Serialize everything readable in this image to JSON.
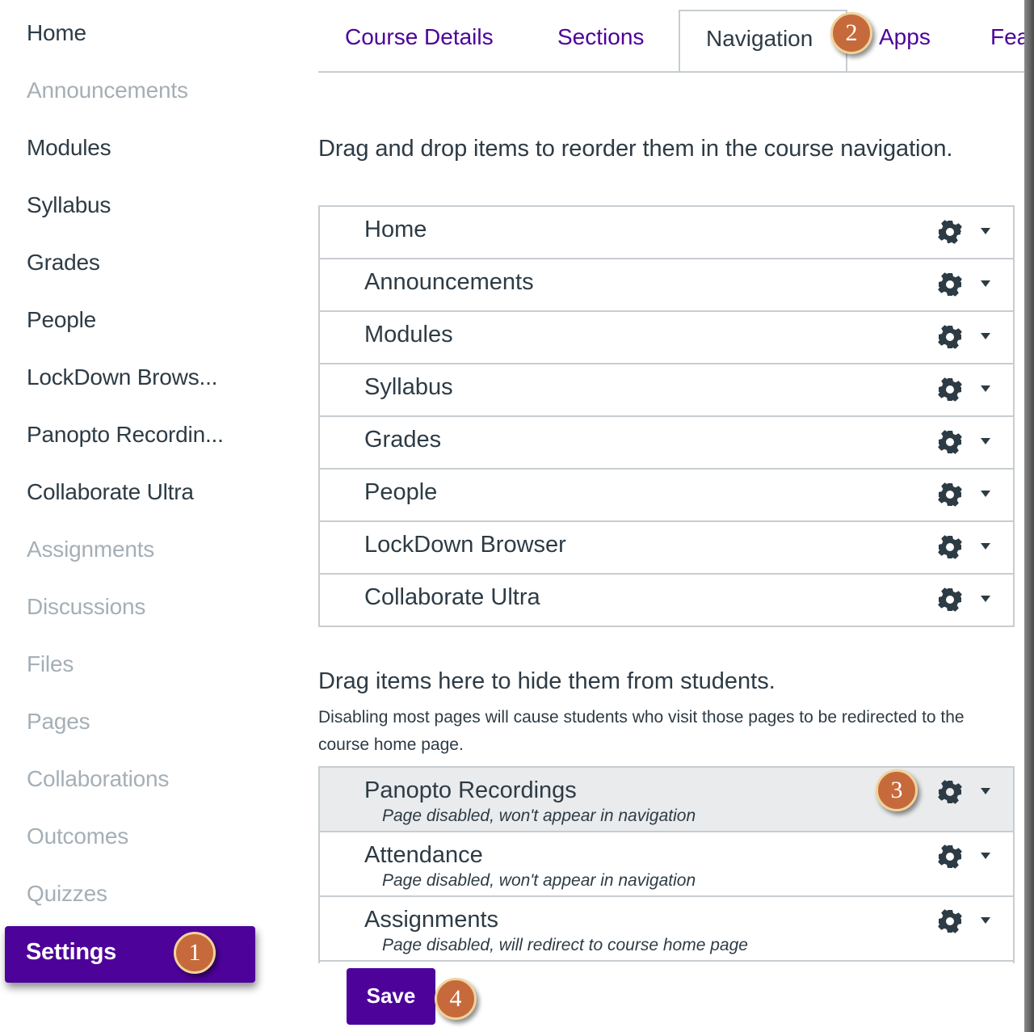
{
  "sidebar": {
    "items": [
      {
        "label": "Home",
        "state": "enabled"
      },
      {
        "label": "Announcements",
        "state": "disabled"
      },
      {
        "label": "Modules",
        "state": "enabled"
      },
      {
        "label": "Syllabus",
        "state": "enabled"
      },
      {
        "label": "Grades",
        "state": "enabled"
      },
      {
        "label": "People",
        "state": "enabled"
      },
      {
        "label": "LockDown Brows...",
        "state": "enabled"
      },
      {
        "label": "Panopto Recordin...",
        "state": "enabled"
      },
      {
        "label": "Collaborate Ultra",
        "state": "enabled"
      },
      {
        "label": "Assignments",
        "state": "disabled"
      },
      {
        "label": "Discussions",
        "state": "disabled"
      },
      {
        "label": "Files",
        "state": "disabled"
      },
      {
        "label": "Pages",
        "state": "disabled"
      },
      {
        "label": "Collaborations",
        "state": "disabled"
      },
      {
        "label": "Outcomes",
        "state": "disabled"
      },
      {
        "label": "Quizzes",
        "state": "disabled"
      }
    ],
    "settings_label": "Settings"
  },
  "tabs": [
    {
      "label": "Course Details"
    },
    {
      "label": "Sections"
    },
    {
      "label": "Navigation",
      "active": true
    },
    {
      "label": "Apps"
    },
    {
      "label": "Fea"
    }
  ],
  "main": {
    "instruction": "Drag and drop items to reorder them in the course navigation.",
    "nav_items": [
      "Home",
      "Announcements",
      "Modules",
      "Syllabus",
      "Grades",
      "People",
      "LockDown Browser",
      "Collaborate Ultra"
    ],
    "hide_title": "Drag items here to hide them from students.",
    "hide_subtitle": "Disabling most pages will cause students who visit those pages to be redirected to the course home page.",
    "hidden_items": [
      {
        "name": "Panopto Recordings",
        "note": "Page disabled, won't appear in navigation"
      },
      {
        "name": "Attendance",
        "note": "Page disabled, won't appear in navigation"
      },
      {
        "name": "Assignments",
        "note": "Page disabled, will redirect to course home page"
      }
    ],
    "save_label": "Save"
  },
  "callouts": [
    "1",
    "2",
    "3",
    "4"
  ],
  "colors": {
    "brand_purple": "#4d0299",
    "callout_fill": "#c66a3c",
    "callout_ring": "#f1d39a",
    "text_dark": "#2d3b45",
    "text_disabled": "#a5afb5",
    "highlight_row": "#e9ebed"
  },
  "icons": {
    "gear": "gear-icon",
    "caret": "caret-down-icon"
  }
}
